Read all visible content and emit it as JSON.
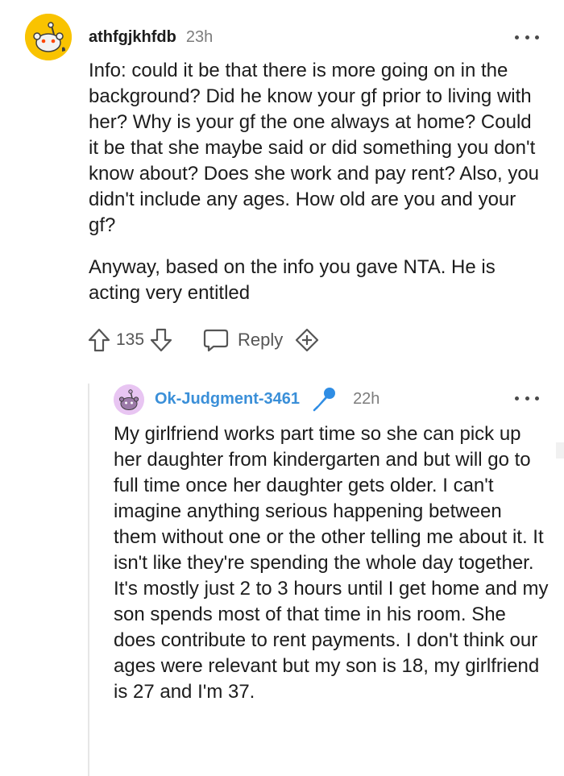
{
  "comment": {
    "username": "athfgjkhfdb",
    "timestamp": "23h",
    "paragraphs": [
      "Info: could it be that there is more going on in the background? Did he know your gf prior to living with her? Why is your gf the one always at home? Could it be that she maybe said or did something you don't know about? Does she work and pay rent? Also, you didn't include any ages. How old are you and your gf?",
      "Anyway, based on the info you gave NTA. He is acting very entitled"
    ],
    "vote_count": "135",
    "reply_label": "Reply",
    "icons": {
      "avatar": "snoo-avatar",
      "upvote": "arrow-up-icon",
      "downvote": "arrow-down-icon",
      "reply": "speech-bubble-icon",
      "award": "award-plus-icon",
      "more": "more-dots-icon"
    },
    "colors": {
      "avatar_bg": "#f9c300"
    }
  },
  "reply": {
    "username": "Ok-Judgment-3461",
    "timestamp": "22h",
    "text": "My girlfriend works part time so she can pick up her daughter from kindergarten and but will go to full time once her daughter gets older. I can't imagine anything serious happening between them without one or the other telling me about it. It isn't like they're spending the whole day together. It's mostly just 2 to 3 hours until I get home and my son spends most of that time in his room. She does contribute to rent payments. I don't think our ages were relevant but my son is 18, my girlfriend is 27 and I'm 37.",
    "icons": {
      "avatar": "snoo-avatar",
      "op_badge": "microphone-icon",
      "more": "more-dots-icon"
    },
    "colors": {
      "username": "#3a8fd8",
      "avatar_bg": "#e8c5f2",
      "op_badge": "#2f8de4"
    }
  }
}
